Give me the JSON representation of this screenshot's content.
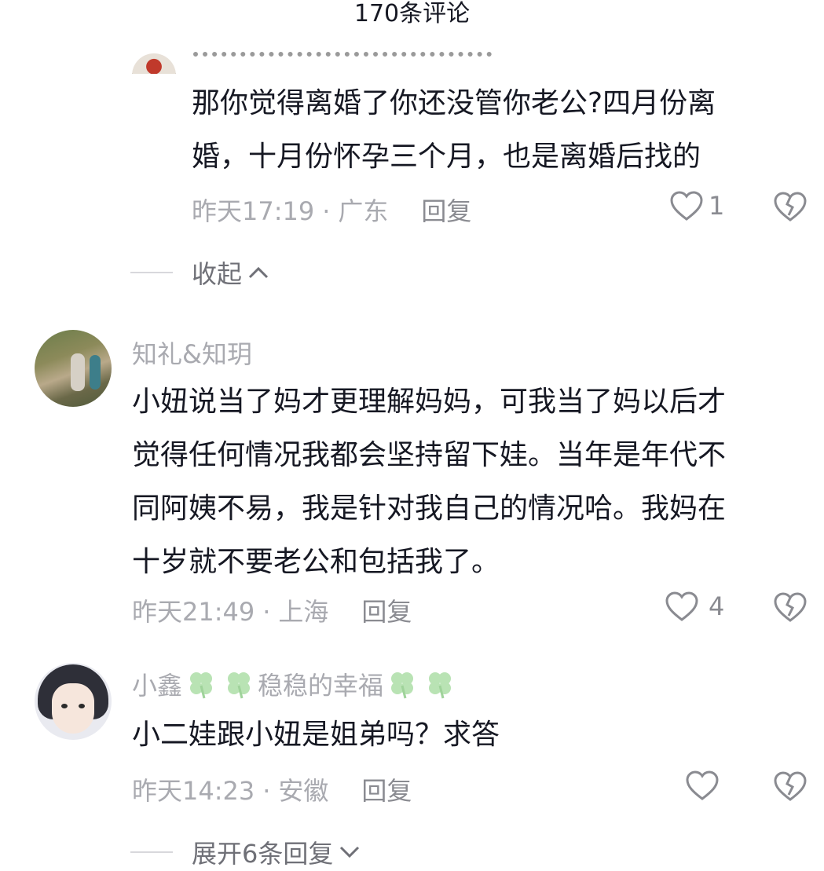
{
  "header": {
    "title": "170条评论"
  },
  "reply_comment": {
    "text_line1": "那你觉得离婚了你还没管你老公?四月份离",
    "text_line2": "婚，十月份怀孕三个月，也是离婚后找的",
    "time": "昨天17:19",
    "separator": "·",
    "location": "广东",
    "reply_label": "回复",
    "likes": "1",
    "like_icon": "heart-outline-icon",
    "dislike_icon": "broken-heart-icon"
  },
  "collapse": {
    "label": "收起"
  },
  "comments": [
    {
      "username": "知礼&知玥",
      "lines": [
        "小妞说当了妈才更理解妈妈，可我当了妈以后才",
        "觉得任何情况我都会坚持留下娃。当年是年代不",
        "同阿姨不易，我是针对我自己的情况哈。我妈在",
        "十岁就不要老公和包括我了。"
      ],
      "time": "昨天21:49",
      "separator": "·",
      "location": "上海",
      "reply_label": "回复",
      "likes": "4"
    },
    {
      "username_part1": "小鑫",
      "username_part2": "稳稳的幸福",
      "clover_icon": "four-leaf-clover-icon",
      "text": "小二娃跟小妞是姐弟吗？求答",
      "time": "昨天14:23",
      "separator": "·",
      "location": "安徽",
      "reply_label": "回复",
      "likes": ""
    }
  ],
  "expand": {
    "label": "展开6条回复"
  },
  "colors": {
    "text": "#161823",
    "meta": "#a9aab0",
    "clover": "#b9e3b4"
  }
}
